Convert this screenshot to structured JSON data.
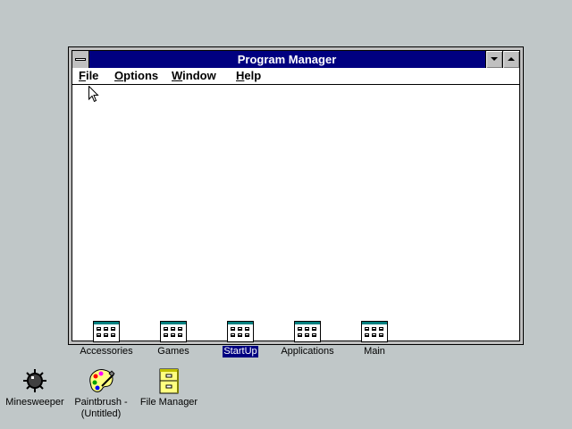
{
  "window": {
    "title": "Program Manager"
  },
  "menu": {
    "file": "File",
    "options": "Options",
    "window": "Window",
    "help": "Help"
  },
  "groups": [
    {
      "label": "Accessories",
      "icon": "program-group-icon"
    },
    {
      "label": "Games",
      "icon": "program-group-icon"
    },
    {
      "label": "StartUp",
      "icon": "program-group-icon",
      "selected": true
    },
    {
      "label": "Applications",
      "icon": "program-group-icon"
    },
    {
      "label": "Main",
      "icon": "program-group-icon"
    }
  ],
  "desktop": [
    {
      "label": "Minesweeper",
      "icon": "mine-icon"
    },
    {
      "label_line1": "Paintbrush -",
      "label_line2": "(Untitled)",
      "icon": "palette-icon"
    },
    {
      "label": "File Manager",
      "icon": "file-cabinet-icon"
    }
  ],
  "colors": {
    "desktop": "#c0c7c8",
    "titlebar": "#000080",
    "selection": "#000080"
  }
}
